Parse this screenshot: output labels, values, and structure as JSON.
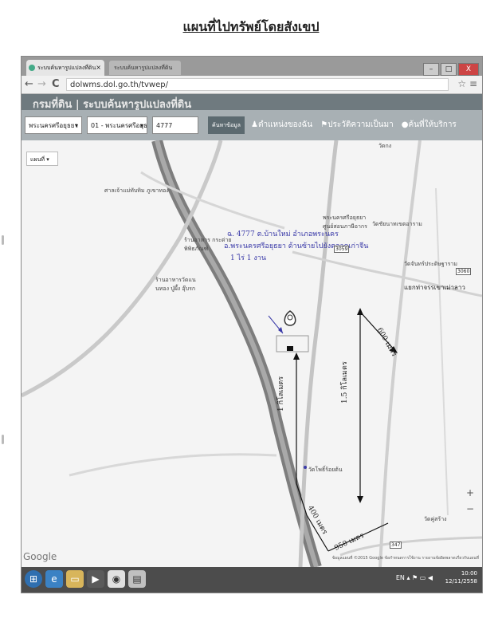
{
  "document": {
    "title": "แผนที่ไปทรัพย์โดยสังเขป"
  },
  "browser": {
    "tab_active": "ระบบค้นหารูปแปลงที่ดิน",
    "tab_close": "×",
    "tab_inactive": "ระบบค้นหารูปแปลงที่ดิน",
    "back": "←",
    "forward": "→",
    "reload": "C",
    "url": "dolwms.dol.go.th/tvwep/",
    "star": "☆",
    "menu_icon": "≡",
    "window_buttons": [
      "–",
      "□",
      "X"
    ]
  },
  "site": {
    "title": "กรมที่ดิน | ระบบค้นหารูปแปลงที่ดิน",
    "province": "พระนครศรีอยุธยา",
    "district": "01 - พระนครศรีอยุธยา",
    "parcel_no": "4777",
    "search_button": "ค้นหาข้อมูล",
    "menu": [
      "ตำแหน่งของฉัน",
      "ประวัติความเป็นมา",
      "ค้นที่ให้บริการ"
    ]
  },
  "map": {
    "map_type": "แผนที่",
    "place_labels": [
      "วัดกง",
      "ศาลเจ้าแม่ทับทิม ภูเขาทอง",
      "ร้านอาหาร กระต่ายพิพิธภัณฑ์",
      "ร้านอาหารวัดแนนทอง ปู่ผึ้ง อุ๊บรก",
      "พระนครศรีอยุธยา ศูนย์สอนภาษีอากร",
      "วัดจันทร์ประดิษฐาราม",
      "วัดโพธิ์ร้อยต้น",
      "วัดคู่สร้าง",
      "วัดชัยนาทเขตอาราม"
    ],
    "handwritten_note": [
      "ฉ. 4777 ต.บ้านใหม่ อำเภอพระนคร",
      "อ.พระนครศรีอยุธยา ด้านซ้ายไปยังตลาดเก่าจีน",
      "1 ไร่ 1 งาน"
    ],
    "distance_labels": [
      "1 กิโลเมตร",
      "1.5 กิโลเมตร",
      "600 เมตร",
      "400 เมตร",
      "950 เมตร"
    ],
    "landmark_label": "แยกท่าจรรเขาเม่าลาว",
    "road_badges": [
      "3059",
      "3060",
      "347"
    ],
    "google_logo": "Google",
    "footer": "ข้อมูลแผนที่ ©2015 Google ข้อกำหนดการใช้งาน รายงานข้อผิดพลาดเกี่ยวกับแผนที่"
  },
  "taskbar": {
    "lang": "EN",
    "time": "10:00",
    "date": "12/11/2558"
  }
}
